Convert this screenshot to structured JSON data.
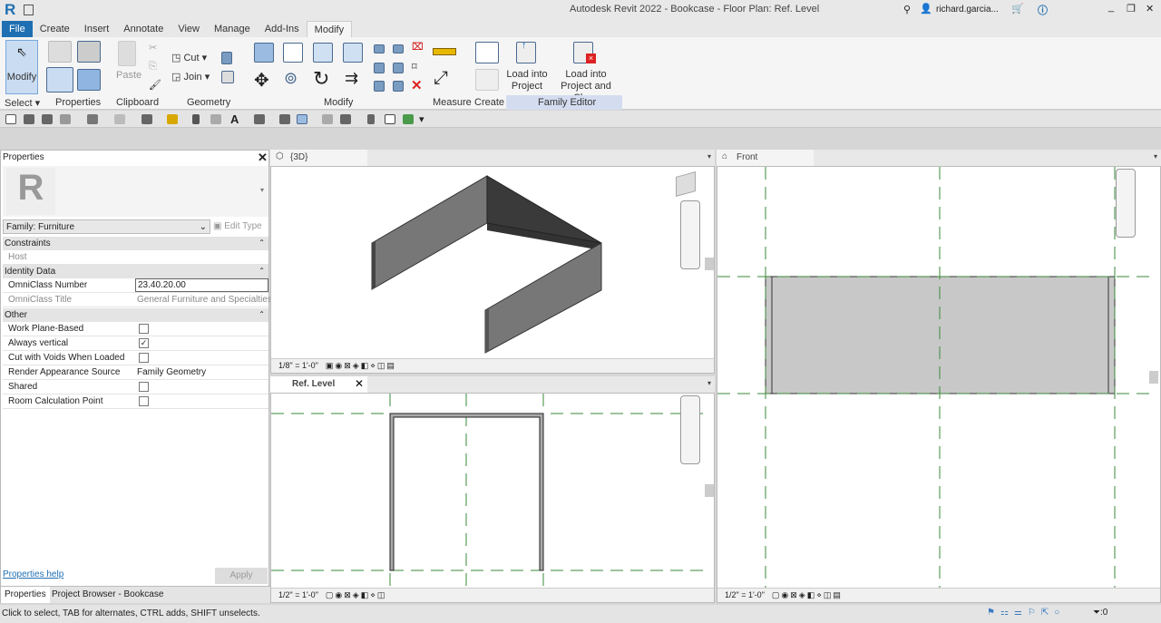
{
  "app": {
    "title": "Autodesk Revit 2022 - Bookcase - Floor Plan: Ref. Level",
    "user": "richard.garcia...",
    "logo": "R"
  },
  "tabs": [
    "File",
    "Create",
    "Insert",
    "Annotate",
    "View",
    "Manage",
    "Add-Ins",
    "Modify"
  ],
  "ribbon": {
    "modify_button": "Modify",
    "paste": "Paste",
    "cut": "Cut",
    "join": "Join",
    "load_into_project": [
      "Load into",
      "Project"
    ],
    "load_into_project_close": [
      "Load into",
      "Project and Close"
    ],
    "panels": [
      "Select",
      "Properties",
      "Clipboard",
      "Geometry",
      "Modify",
      "Measure",
      "Create",
      "Family Editor"
    ]
  },
  "properties": {
    "title": "Properties",
    "family": "Family: Furniture",
    "edit_type": "Edit Type",
    "sections": {
      "constraints": "Constraints",
      "identity": "Identity Data",
      "other": "Other"
    },
    "host": "Host",
    "omniclass_number_label": "OmniClass Number",
    "omniclass_number": "23.40.20.00",
    "omniclass_title_label": "OmniClass Title",
    "omniclass_title": "General Furniture and Specialties",
    "other_rows": [
      {
        "label": "Work Plane-Based",
        "checked": false
      },
      {
        "label": "Always vertical",
        "checked": true
      },
      {
        "label": "Cut with Voids When Loaded",
        "checked": false
      },
      {
        "label": "Render Appearance Source",
        "value": "Family Geometry"
      },
      {
        "label": "Shared",
        "checked": false
      },
      {
        "label": "Room Calculation Point",
        "checked": false
      }
    ],
    "help": "Properties help",
    "apply": "Apply"
  },
  "bottom_tabs": [
    "Properties",
    "Project Browser - Bookcase"
  ],
  "views": {
    "v3d": {
      "title": "{3D}",
      "scale": "1/8\" = 1'-0\""
    },
    "plan": {
      "title": "Ref. Level",
      "scale": "1/2\" = 1'-0\""
    },
    "front": {
      "title": "Front",
      "scale": "1/2\" = 1'-0\""
    }
  },
  "status": {
    "text": "Click to select, TAB for alternates, CTRL adds, SHIFT unselects.",
    "filter_count": ":0"
  },
  "colors": {
    "file_tab": "#1f6fb2",
    "family_editor": "#d4dcf0",
    "ref_plane": "#3a8a3a"
  }
}
